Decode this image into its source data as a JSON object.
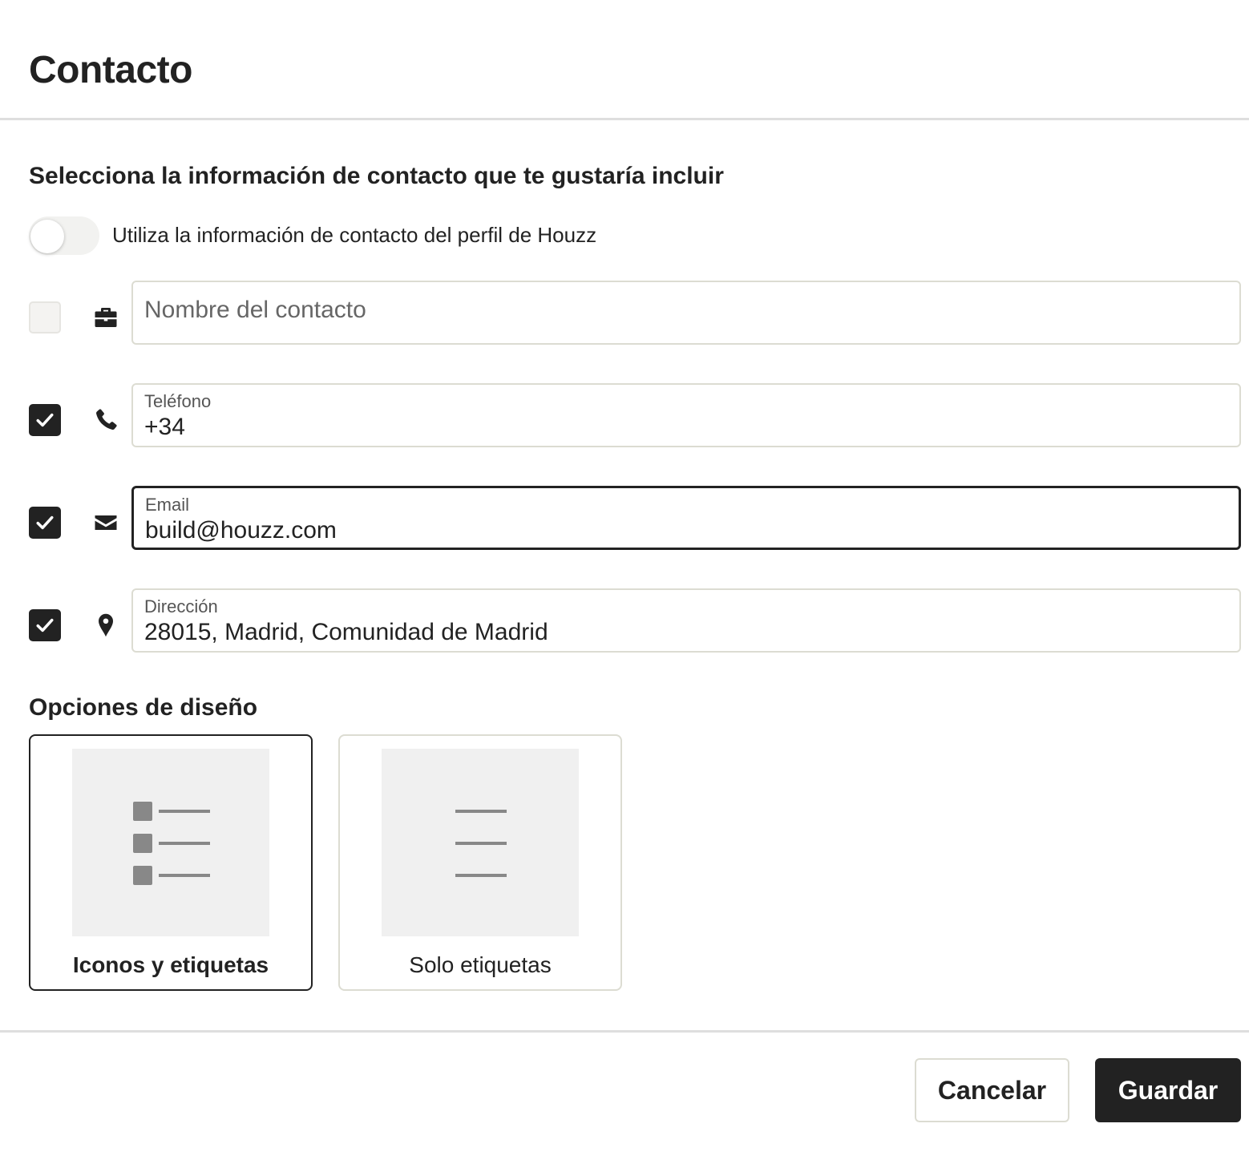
{
  "header": {
    "title": "Contacto"
  },
  "contact_section": {
    "title": "Selecciona la información de contacto que te gustaría incluir",
    "toggle": {
      "label": "Utiliza la información de contacto del perfil de Houzz",
      "on": false
    },
    "fields": {
      "name": {
        "checked": false,
        "icon": "briefcase-icon",
        "placeholder": "Nombre del contacto",
        "value": ""
      },
      "phone": {
        "checked": true,
        "icon": "phone-icon",
        "label": "Teléfono",
        "value": "+34"
      },
      "email": {
        "checked": true,
        "icon": "envelope-icon",
        "label": "Email",
        "value": "build@houzz.com",
        "focused": true
      },
      "address": {
        "checked": true,
        "icon": "location-pin-icon",
        "label": "Dirección",
        "value": "28015, Madrid, Comunidad de Madrid"
      }
    }
  },
  "design_section": {
    "title": "Opciones de diseño",
    "options": [
      {
        "label": "Iconos y etiquetas",
        "selected": true
      },
      {
        "label": "Solo etiquetas",
        "selected": false
      }
    ]
  },
  "footer": {
    "cancel_label": "Cancelar",
    "save_label": "Guardar"
  },
  "colors": {
    "primary": "#222222",
    "border": "#dcdcd2",
    "preview_bg": "#f0f0f0",
    "preview_mark": "#888888"
  }
}
